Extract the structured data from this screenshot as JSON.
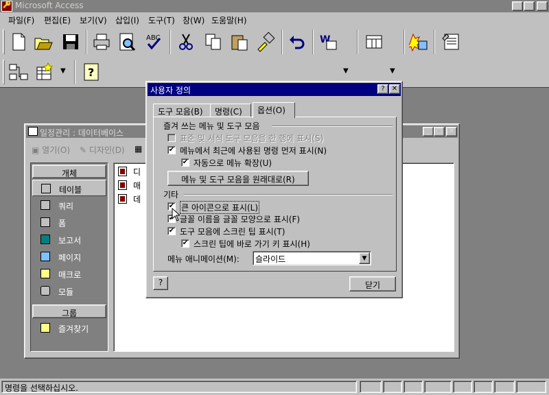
{
  "app": {
    "title": "Microsoft Access"
  },
  "menu": [
    "파일(F)",
    "편집(E)",
    "보기(V)",
    "삽입(I)",
    "도구(T)",
    "창(W)",
    "도움말(H)"
  ],
  "toolbar_icons": [
    "new-icon",
    "open-icon",
    "save-icon",
    "print-icon",
    "print-preview-icon",
    "spelling-icon",
    "cut-icon",
    "copy-icon",
    "paste-icon",
    "format-painter-icon",
    "undo-icon",
    "office-links-icon",
    "analyze-icon",
    "code-icon",
    "properties-icon",
    "relationships-icon",
    "new-object-icon",
    "office-assistant-icon"
  ],
  "db_window": {
    "title": "일정관리 : 데이터베이스",
    "toolbar": {
      "open": "열기(O)",
      "design": "디자인(D)"
    },
    "sidebar": {
      "objects_header": "개체",
      "items": [
        "테이블",
        "쿼리",
        "폼",
        "보고서",
        "페이지",
        "매크로",
        "모듈"
      ],
      "groups_header": "그룹",
      "favorites": "즐겨찾기"
    },
    "list": [
      "디",
      "매",
      "데"
    ]
  },
  "dialog": {
    "title": "사용자 정의",
    "tabs": [
      "도구 모음(B)",
      "명령(C)",
      "옵션(O)"
    ],
    "group1": "즐겨 쓰는 메뉴 및 도구 모음",
    "cb_same_row": "표준 및 서식 도구 모음을 한 행에 표시(S)",
    "cb_recent_first": "메뉴에서 최근에 사용된 명령 먼저 표시(N)",
    "cb_auto_expand": "자동으로 메뉴 확장(U)",
    "reset_button": "메뉴 및 도구 모음을 원래대로(R)",
    "group2": "기타",
    "cb_large_icons": "큰 아이콘으로 표시(L)",
    "cb_font_names": "글꼴 이름을 글꼴 모양으로 표시(F)",
    "cb_screentips": "도구 모음에 스크린 팁 표시(T)",
    "cb_shortcut_keys": "스크린 팁에 바로 가기 키 표시(H)",
    "animation_label": "메뉴 애니메이션(M):",
    "animation_value": "슬라이드",
    "close_button": "닫기"
  },
  "status": {
    "text": "명령을 선택하십시오."
  }
}
